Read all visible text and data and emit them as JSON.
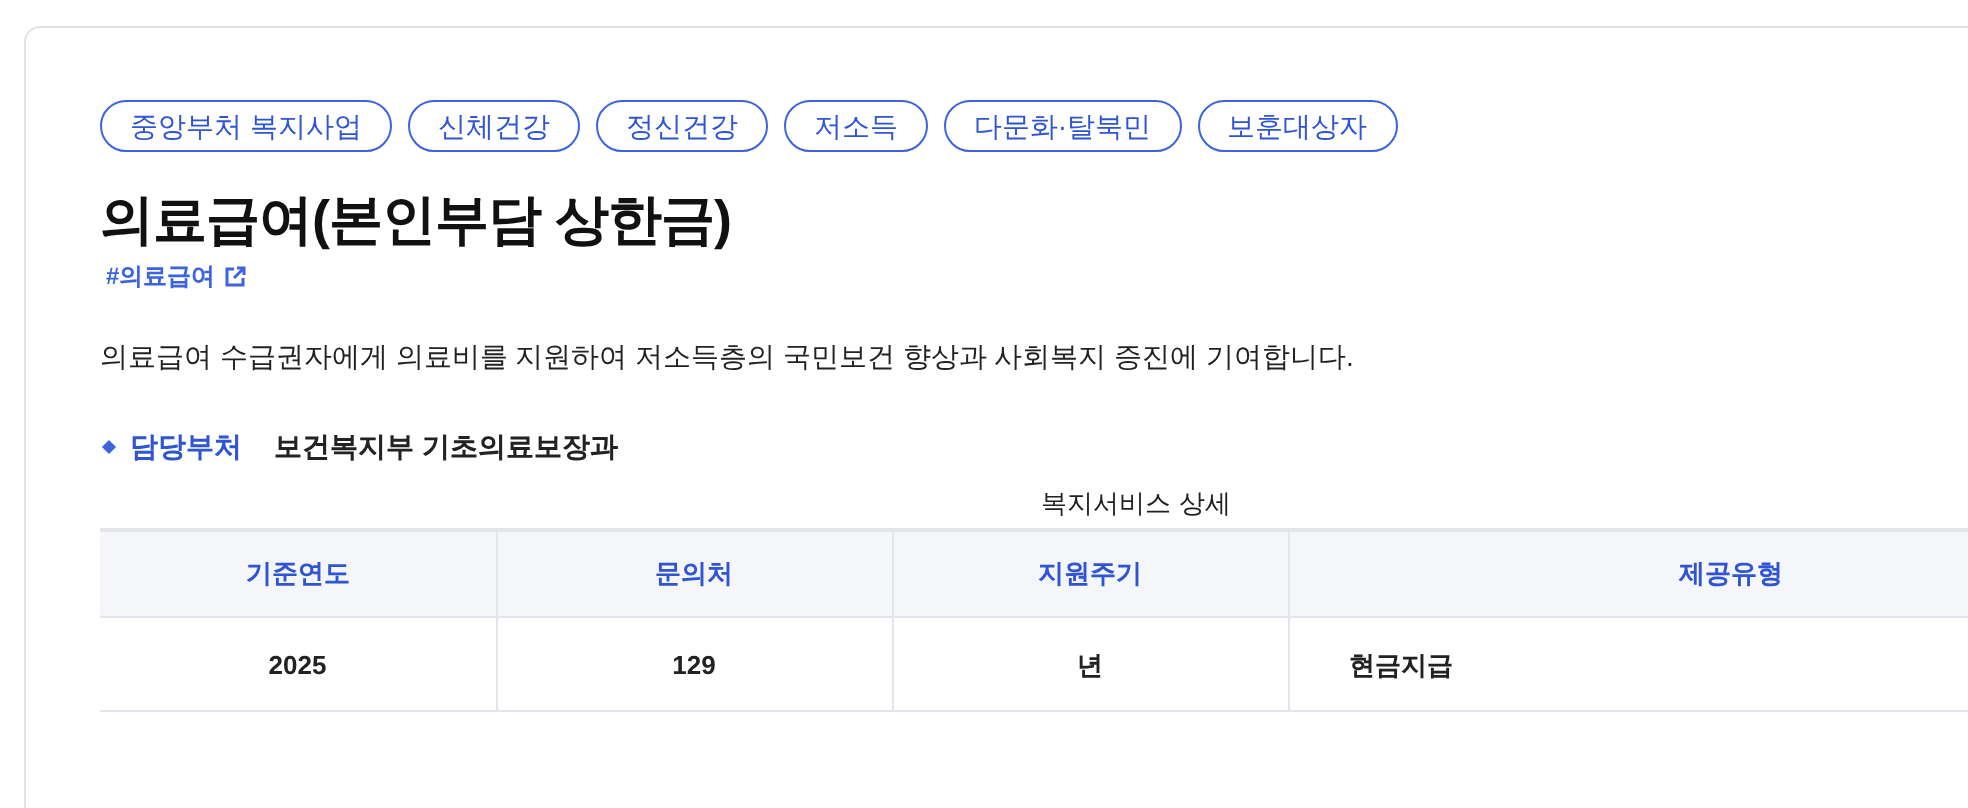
{
  "tags": [
    "중앙부처 복지사업",
    "신체건강",
    "정신건강",
    "저소득",
    "다문화·탈북민",
    "보훈대상자"
  ],
  "title": "의료급여(본인부담 상한금)",
  "hashtag": "#의료급여",
  "description": "의료급여 수급권자에게 의료비를 지원하여 저소득층의 국민보건 향상과 사회복지 증진에 기여합니다.",
  "department": {
    "label": "담당부처",
    "value": "보건복지부 기초의료보장과"
  },
  "table": {
    "caption": "복지서비스 상세",
    "columns": [
      "기준연도",
      "문의처",
      "지원주기",
      "제공유형"
    ],
    "rows": [
      [
        "2025",
        "129",
        "년",
        "현금지급"
      ]
    ]
  }
}
